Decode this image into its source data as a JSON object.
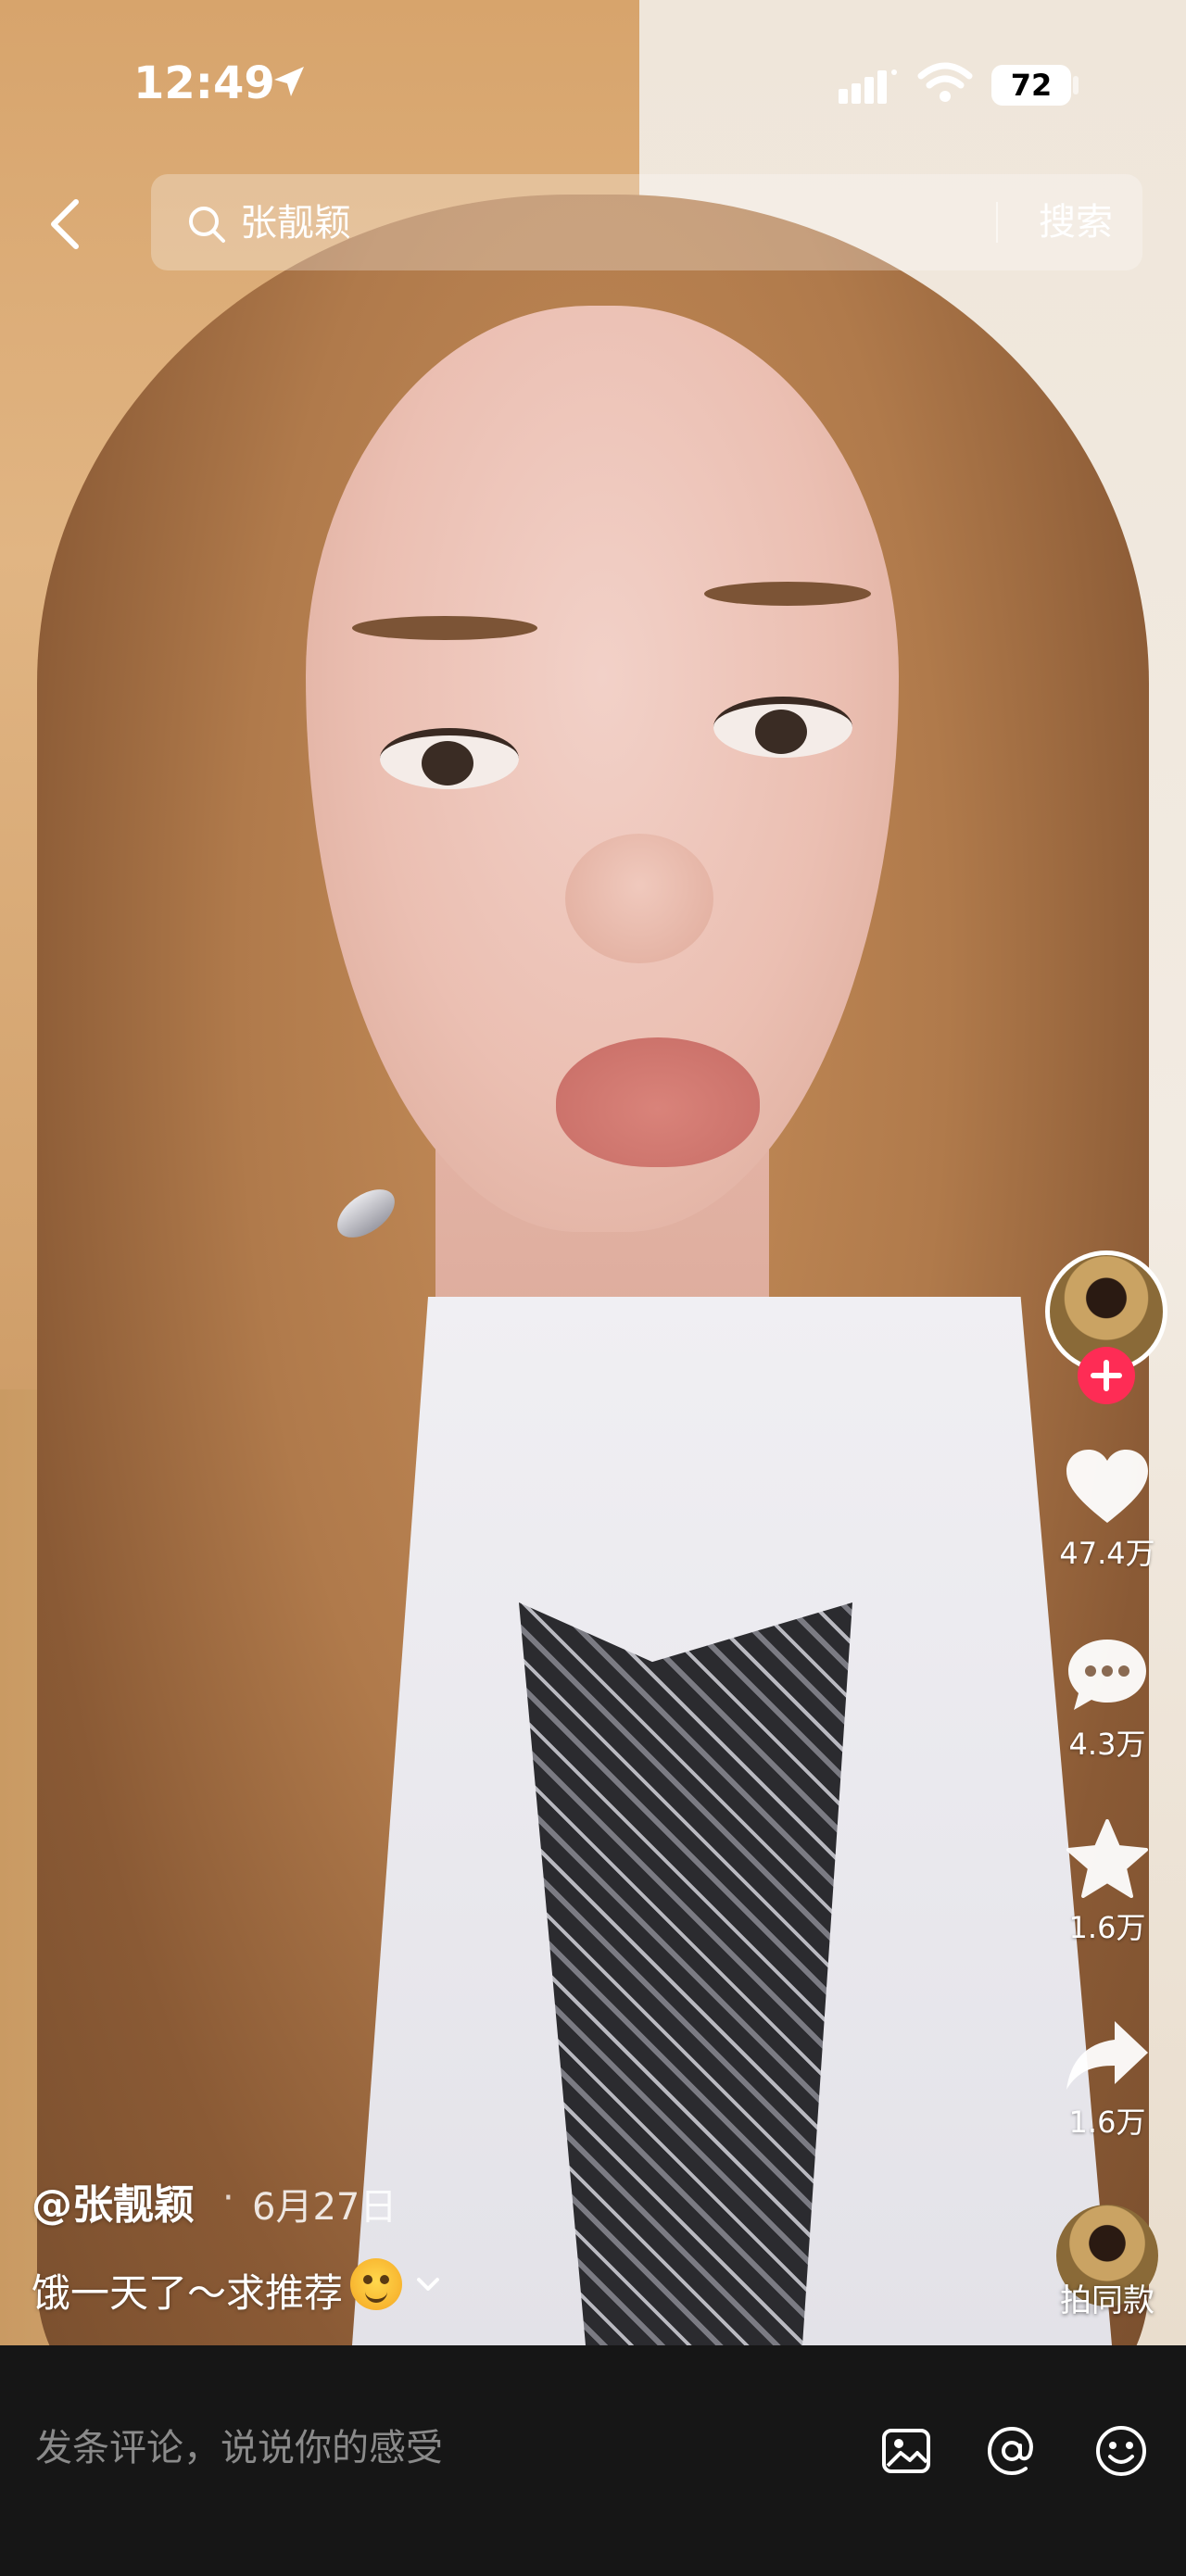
{
  "status_bar": {
    "time": "12:49",
    "battery": "72"
  },
  "search": {
    "placeholder": "张靓颖",
    "button_label": "搜索"
  },
  "actions": {
    "likes": "47.4万",
    "comments": "4.3万",
    "favorites": "1.6万",
    "shares": "1.6万",
    "remix_label": "拍同款"
  },
  "post": {
    "author": "@张靓颖",
    "separator": "·",
    "date": "6月27日",
    "description": "饿一天了～求推荐"
  },
  "comment_bar": {
    "placeholder": "发条评论，说说你的感受"
  },
  "colors": {
    "follow_badge": "#fe2c55",
    "bottom_bar": "#161616"
  }
}
